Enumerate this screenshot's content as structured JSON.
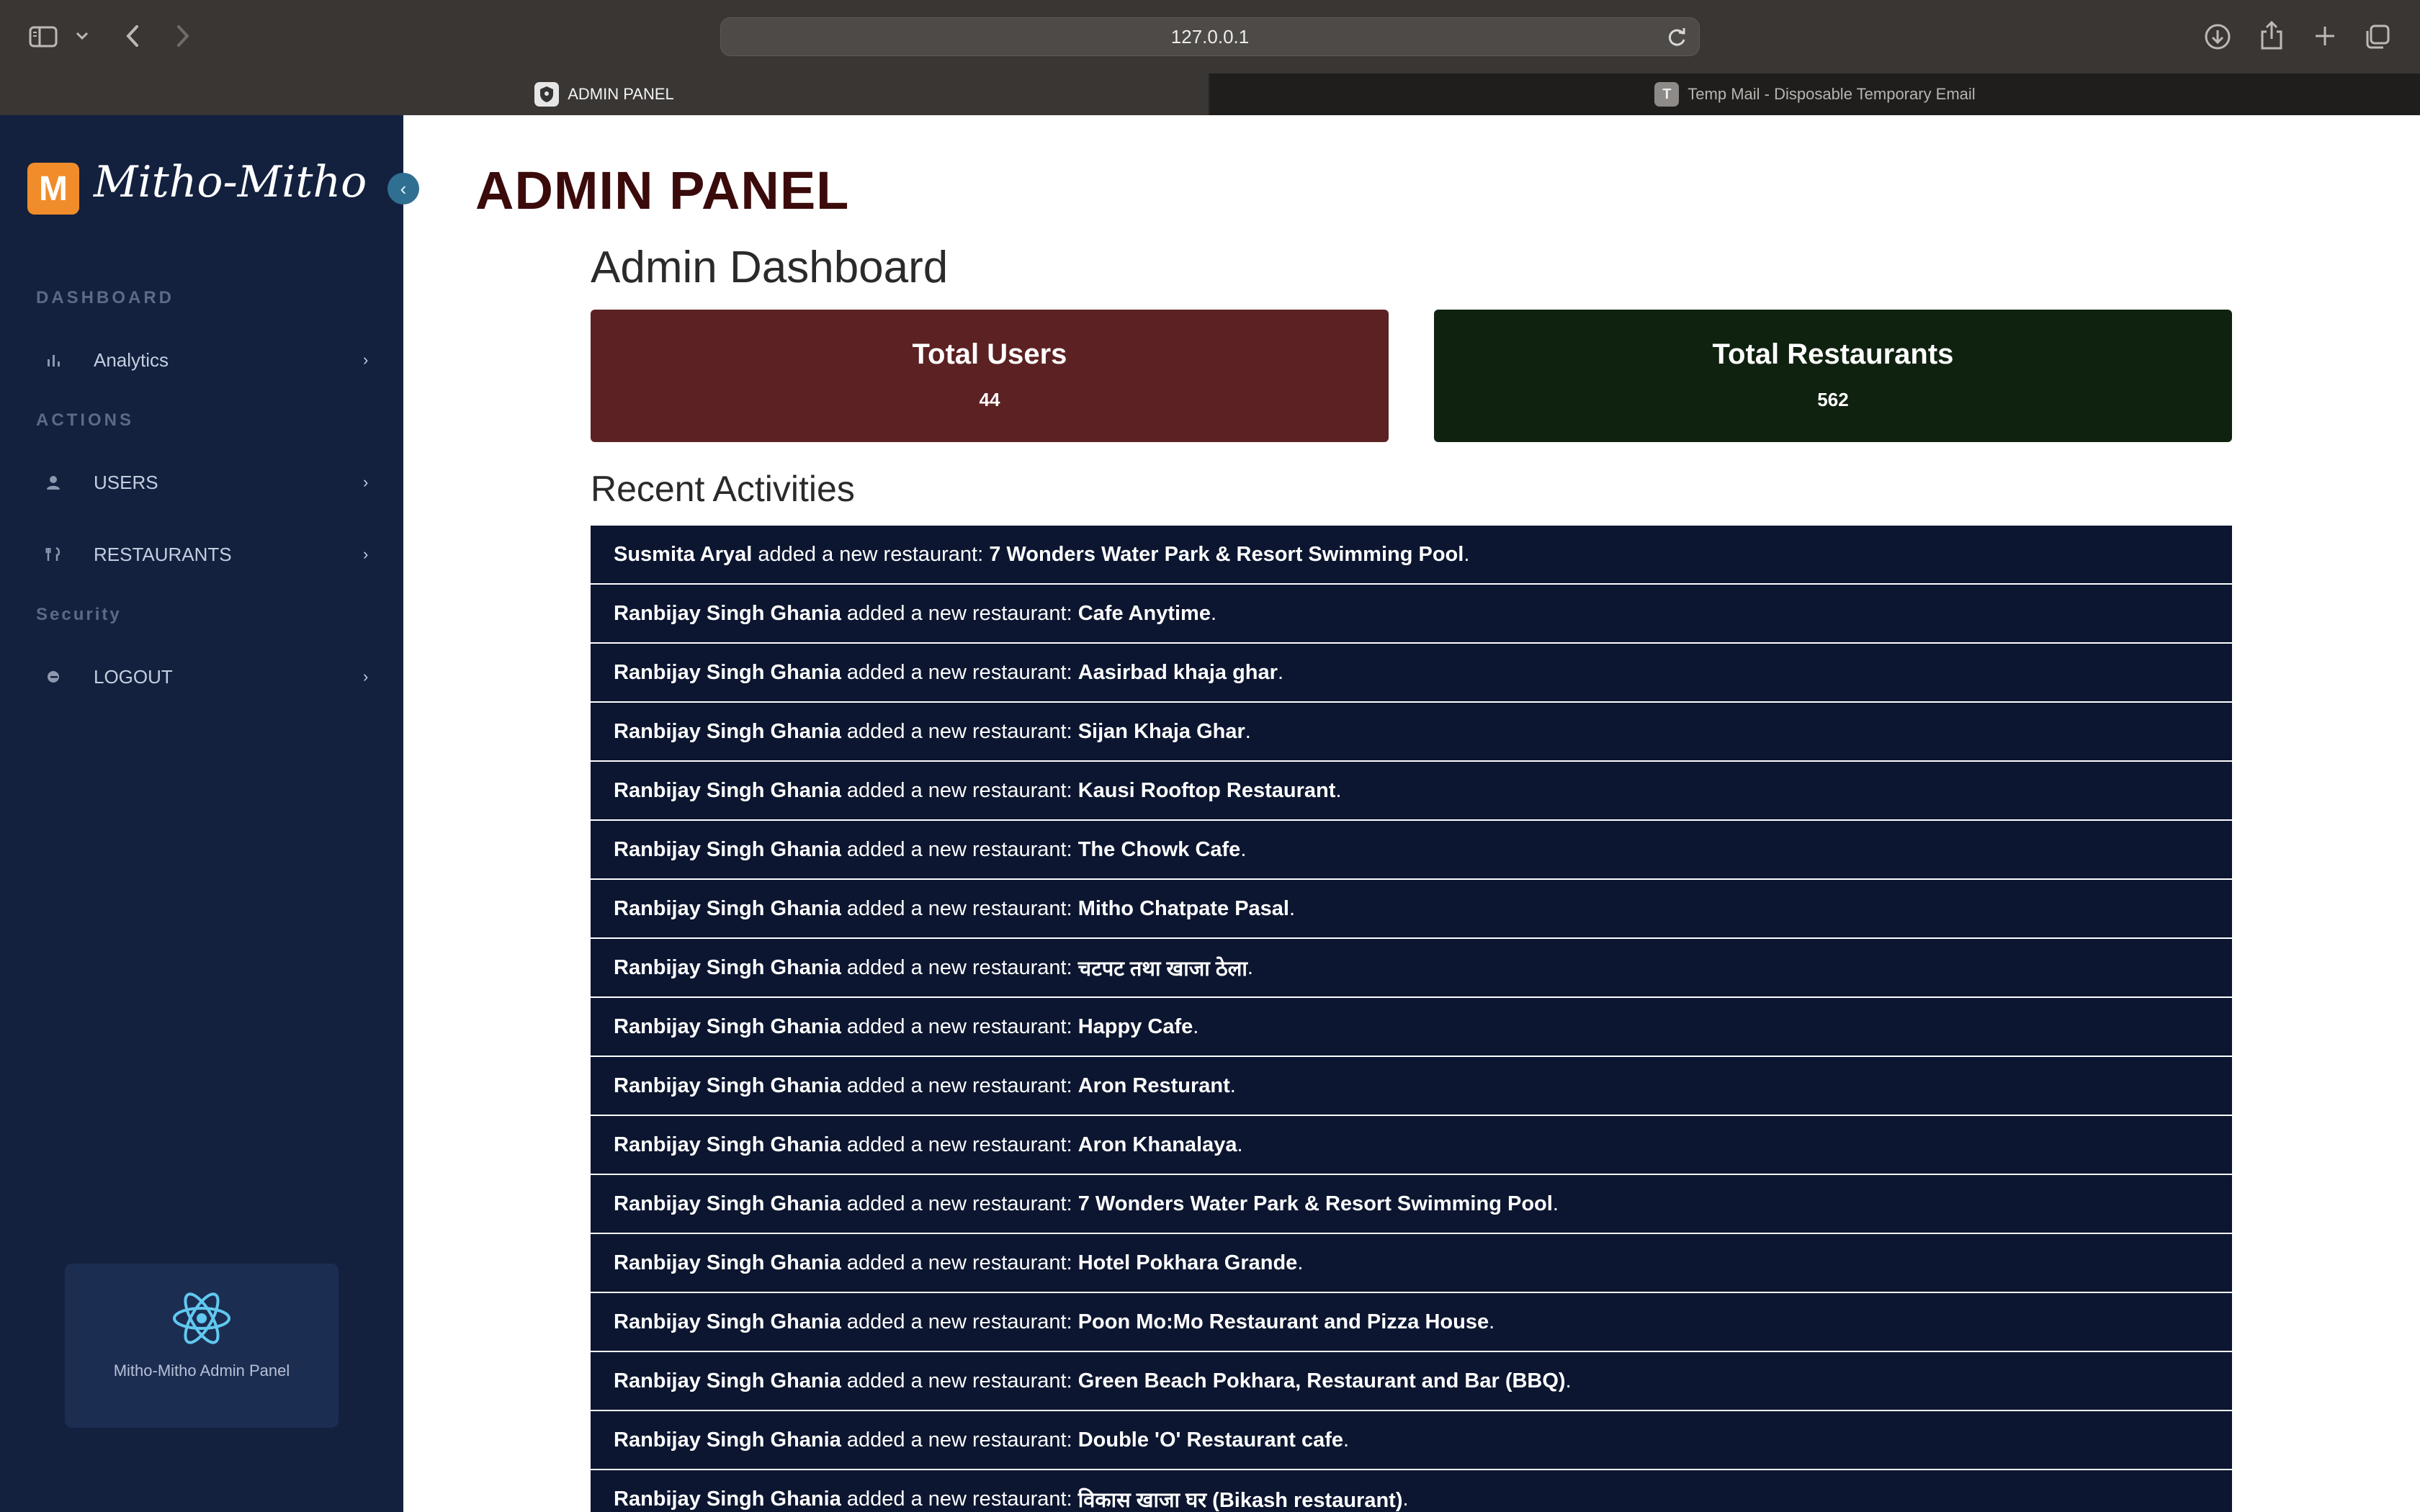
{
  "browser": {
    "url": "127.0.0.1",
    "tabs": [
      {
        "label": "ADMIN PANEL",
        "favicon": "shield-icon"
      },
      {
        "label": "Temp Mail - Disposable Temporary Email",
        "favicon_letter": "T"
      }
    ]
  },
  "sidebar": {
    "logo_letter": "M",
    "brand": "Mitho-Mitho",
    "sections": {
      "dashboard": "DASHBOARD",
      "actions": "ACTIONS",
      "security": "Security"
    },
    "items": [
      {
        "label": "Analytics",
        "icon": "bar-chart-icon"
      },
      {
        "label": "USERS",
        "icon": "user-icon"
      },
      {
        "label": "RESTAURANTS",
        "icon": "utensils-icon"
      },
      {
        "label": "LOGOUT",
        "icon": "logout-icon"
      }
    ],
    "card_text": "Mitho-Mitho Admin Panel"
  },
  "main": {
    "page_title": "ADMIN PANEL",
    "dashboard_title": "Admin Dashboard",
    "stats": {
      "users_label": "Total Users",
      "users_value": "44",
      "restaurants_label": "Total Restaurants",
      "restaurants_value": "562"
    },
    "recent_title": "Recent Activities",
    "action_text": " added a new restaurant: ",
    "activities": [
      {
        "user": "Susmita Aryal",
        "restaurant": "7 Wonders Water Park & Resort Swimming Pool"
      },
      {
        "user": "Ranbijay Singh Ghania",
        "restaurant": "Cafe Anytime"
      },
      {
        "user": "Ranbijay Singh Ghania",
        "restaurant": "Aasirbad khaja ghar"
      },
      {
        "user": "Ranbijay Singh Ghania",
        "restaurant": "Sijan Khaja Ghar"
      },
      {
        "user": "Ranbijay Singh Ghania",
        "restaurant": "Kausi Rooftop Restaurant"
      },
      {
        "user": "Ranbijay Singh Ghania",
        "restaurant": "The Chowk Cafe"
      },
      {
        "user": "Ranbijay Singh Ghania",
        "restaurant": "Mitho Chatpate Pasal"
      },
      {
        "user": "Ranbijay Singh Ghania",
        "restaurant": "चटपट तथा खाजा ठेला"
      },
      {
        "user": "Ranbijay Singh Ghania",
        "restaurant": "Happy Cafe"
      },
      {
        "user": "Ranbijay Singh Ghania",
        "restaurant": "Aron Resturant"
      },
      {
        "user": "Ranbijay Singh Ghania",
        "restaurant": "Aron Khanalaya"
      },
      {
        "user": "Ranbijay Singh Ghania",
        "restaurant": "7 Wonders Water Park & Resort Swimming Pool"
      },
      {
        "user": "Ranbijay Singh Ghania",
        "restaurant": "Hotel Pokhara Grande"
      },
      {
        "user": "Ranbijay Singh Ghania",
        "restaurant": "Poon Mo:Mo Restaurant and Pizza House"
      },
      {
        "user": "Ranbijay Singh Ghania",
        "restaurant": "Green Beach Pokhara, Restaurant and Bar (BBQ)"
      },
      {
        "user": "Ranbijay Singh Ghania",
        "restaurant": "Double 'O' Restaurant cafe"
      },
      {
        "user": "Ranbijay Singh Ghania",
        "restaurant": "विकास खाजा घर (Bikash restaurant)"
      }
    ]
  }
}
